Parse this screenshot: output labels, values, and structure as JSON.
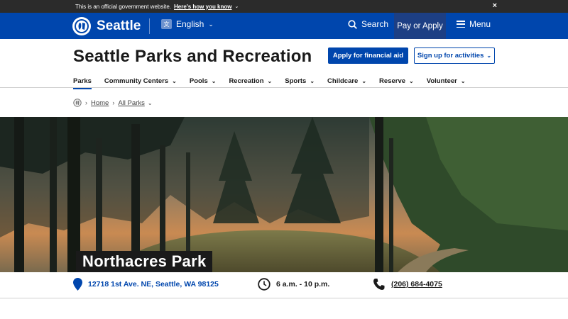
{
  "gov_banner": {
    "text": "This is an official government website.",
    "link": "Here's how you know",
    "close": "×"
  },
  "topbar": {
    "logo_text": "Seattle",
    "language": "English",
    "search": "Search",
    "pay_or_apply": "Pay or Apply",
    "menu": "Menu"
  },
  "header": {
    "title": "Seattle Parks and Recreation",
    "btn_financial_aid": "Apply for financial aid",
    "btn_signup": "Sign up for activities"
  },
  "nav": [
    {
      "label": "Parks"
    },
    {
      "label": "Community Centers"
    },
    {
      "label": "Pools"
    },
    {
      "label": "Recreation"
    },
    {
      "label": "Sports"
    },
    {
      "label": "Childcare"
    },
    {
      "label": "Reserve"
    },
    {
      "label": "Volunteer"
    }
  ],
  "breadcrumb": {
    "home": "Home",
    "all_parks": "All Parks"
  },
  "park": {
    "title": "Northacres Park",
    "address": "12718 1st Ave. NE, Seattle, WA 98125",
    "hours": "6 a.m. - 10 p.m.",
    "phone": "(206) 684-4075"
  },
  "colors": {
    "brand_blue": "#0046ad",
    "pay_blue": "#1d3f84",
    "banner_dark": "#2b2b2b"
  }
}
